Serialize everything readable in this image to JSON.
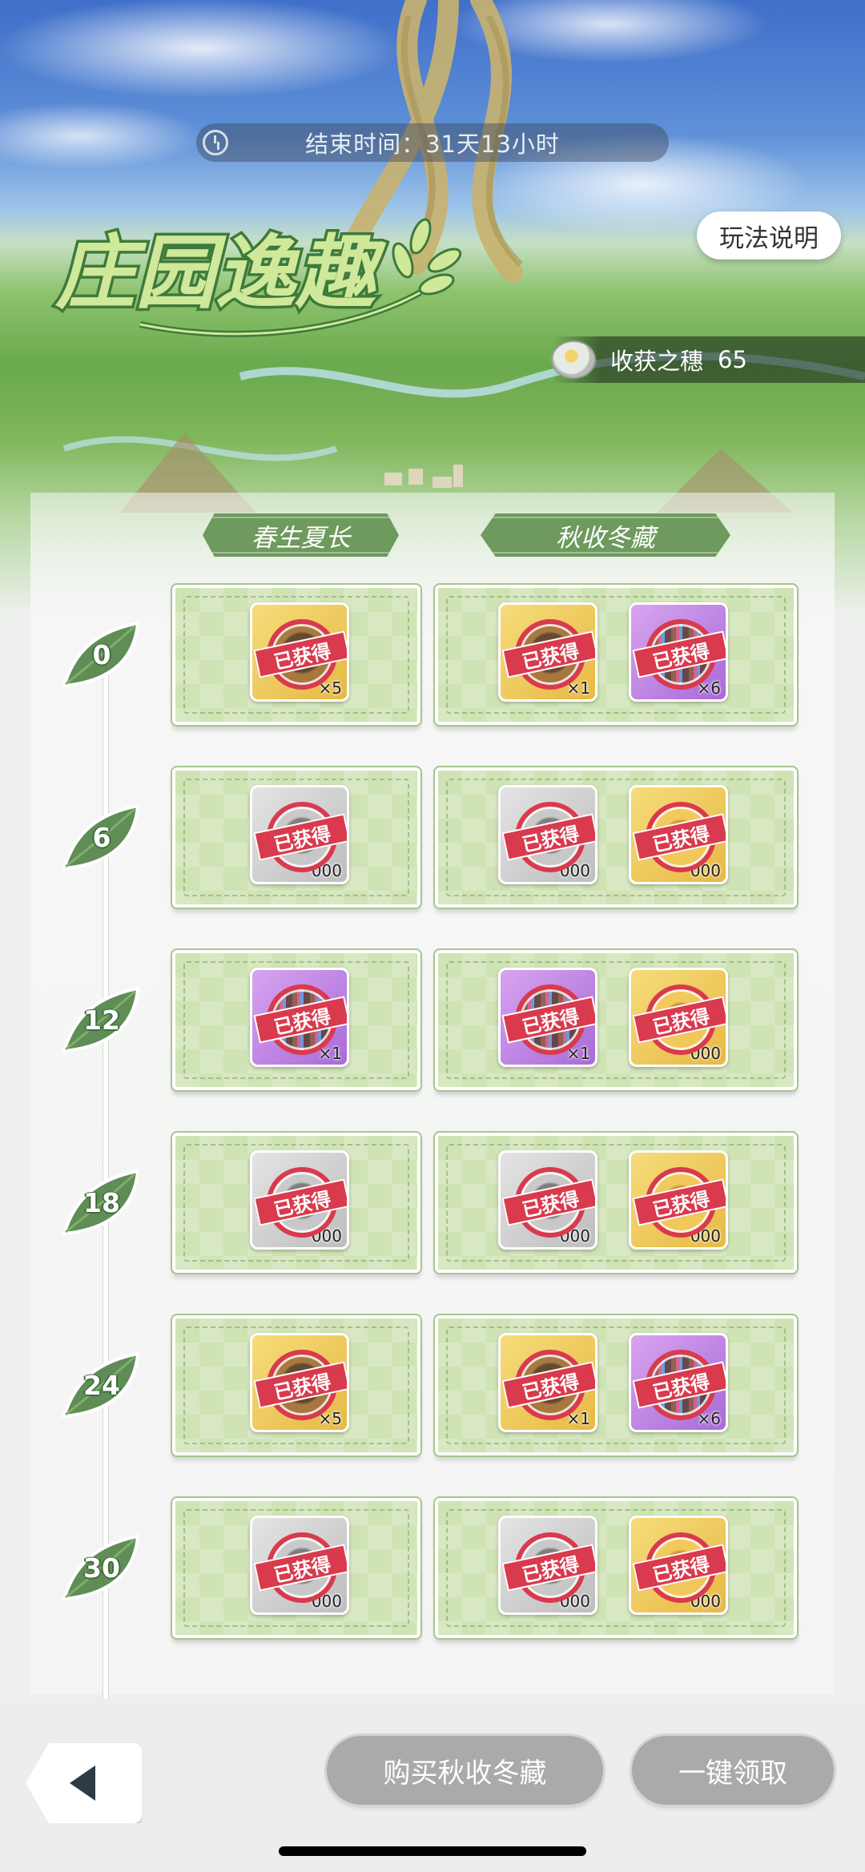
{
  "header": {
    "timer_text": "结束时间：31天13小时",
    "help_label": "玩法说明",
    "logo_text": "庄园逸趣",
    "currency_label": "收获之穗",
    "currency_value": "65"
  },
  "columns": {
    "left": "春生夏长",
    "right": "秋收冬藏"
  },
  "claimed_label": "已获得",
  "rows": [
    {
      "level": "0",
      "items": [
        {
          "kind": "gold",
          "qty": "×5"
        },
        {
          "kind": "gold",
          "qty": "×1"
        },
        {
          "kind": "purple",
          "qty": "×6"
        }
      ]
    },
    {
      "level": "6",
      "items": [
        {
          "kind": "grey",
          "qty": "000"
        },
        {
          "kind": "grey",
          "qty": "000"
        },
        {
          "kind": "coin",
          "qty": "000"
        }
      ]
    },
    {
      "level": "12",
      "items": [
        {
          "kind": "purple",
          "qty": "×1"
        },
        {
          "kind": "purple",
          "qty": "×1"
        },
        {
          "kind": "coin",
          "qty": "000"
        }
      ]
    },
    {
      "level": "18",
      "items": [
        {
          "kind": "grey",
          "qty": "000"
        },
        {
          "kind": "grey",
          "qty": "000"
        },
        {
          "kind": "coin",
          "qty": "000"
        }
      ]
    },
    {
      "level": "24",
      "items": [
        {
          "kind": "gold",
          "qty": "×5"
        },
        {
          "kind": "gold",
          "qty": "×1"
        },
        {
          "kind": "purple",
          "qty": "×6"
        }
      ]
    },
    {
      "level": "30",
      "items": [
        {
          "kind": "grey",
          "qty": "000"
        },
        {
          "kind": "grey",
          "qty": "000"
        },
        {
          "kind": "coin",
          "qty": "000"
        }
      ]
    }
  ],
  "footer": {
    "buy_label": "购买秋收冬藏",
    "claim_all_label": "一键领取"
  },
  "colors": {
    "accent_green": "#6e9a5d",
    "ticket_green": "#cfe3b5",
    "stamp_red": "#d93a4d",
    "button_grey": "#a9aaa9"
  }
}
